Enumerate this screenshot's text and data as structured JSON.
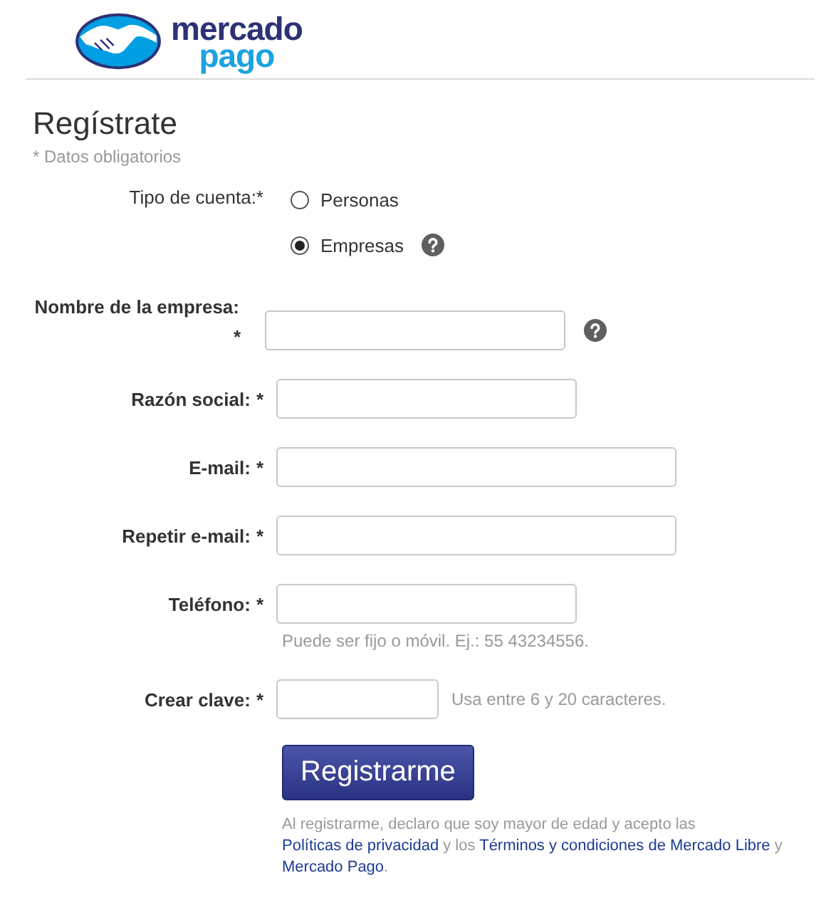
{
  "logo": {
    "line1": "mercado",
    "line2": "pago"
  },
  "title": "Regístrate",
  "required_note": "* Datos obligatorios",
  "account_type": {
    "label": "Tipo de cuenta:*",
    "options": [
      {
        "label": "Personas",
        "selected": false
      },
      {
        "label": "Empresas",
        "selected": true,
        "help": true
      }
    ]
  },
  "fields": [
    {
      "label": "Nombre de la empresa:",
      "mark": "*",
      "help": true
    },
    {
      "label": "Razón social:",
      "mark": "*"
    },
    {
      "label": "E-mail:",
      "mark": "*"
    },
    {
      "label": "Repetir e-mail:",
      "mark": "*"
    },
    {
      "label": "Teléfono:",
      "mark": "*",
      "hint": "Puede ser fijo o móvil. Ej.: 55 43234556."
    },
    {
      "label": "Crear clave:",
      "mark": "*",
      "side_hint": "Usa entre 6 y 20 caracteres."
    }
  ],
  "submit": "Registrarme",
  "legal": [
    {
      "kind": "text",
      "text": "Al registrarme, declaro que soy mayor de edad y acepto las "
    },
    {
      "kind": "link",
      "text": "Políticas de privacidad"
    },
    {
      "kind": "text",
      "text": " y los "
    },
    {
      "kind": "link",
      "text": "Términos y condiciones de Mercado Libre"
    },
    {
      "kind": "text",
      "text": " y "
    },
    {
      "kind": "link",
      "text": "Mercado Pago"
    },
    {
      "kind": "text",
      "text": "."
    }
  ]
}
